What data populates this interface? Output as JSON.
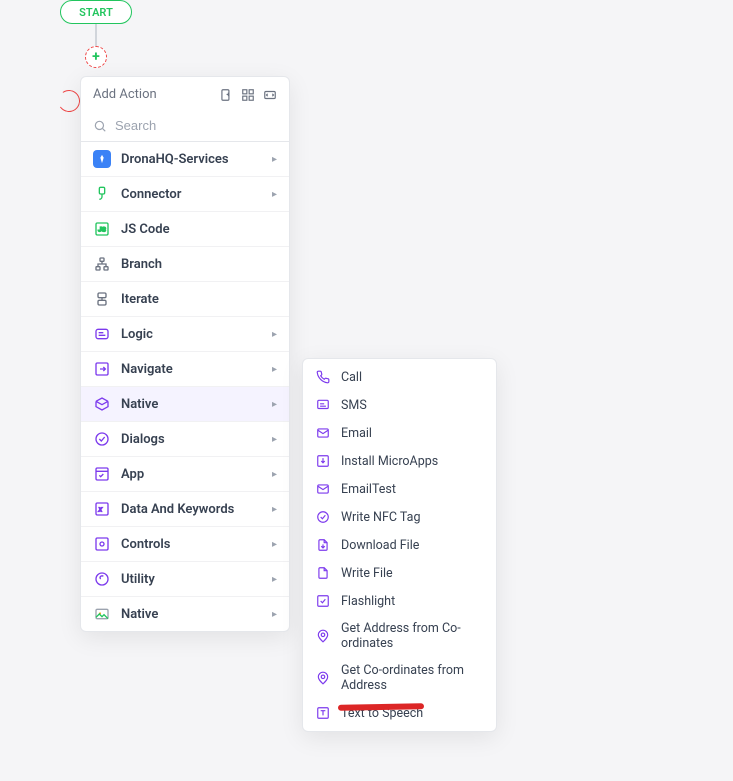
{
  "canvas": {
    "start_label": "START"
  },
  "menu": {
    "title": "Add Action",
    "search_placeholder": "Search",
    "items": [
      {
        "label": "DronaHQ-Services",
        "expand": true
      },
      {
        "label": "Connector",
        "expand": true
      },
      {
        "label": "JS Code",
        "expand": false
      },
      {
        "label": "Branch",
        "expand": false
      },
      {
        "label": "Iterate",
        "expand": false
      },
      {
        "label": "Logic",
        "expand": true
      },
      {
        "label": "Navigate",
        "expand": true
      },
      {
        "label": "Native",
        "expand": true
      },
      {
        "label": "Dialogs",
        "expand": true
      },
      {
        "label": "App",
        "expand": true
      },
      {
        "label": "Data And Keywords",
        "expand": true
      },
      {
        "label": "Controls",
        "expand": true
      },
      {
        "label": "Utility",
        "expand": true
      },
      {
        "label": "Native",
        "expand": true
      }
    ]
  },
  "submenu": {
    "items": [
      {
        "label": "Call"
      },
      {
        "label": "SMS"
      },
      {
        "label": "Email"
      },
      {
        "label": "Install MicroApps"
      },
      {
        "label": "EmailTest"
      },
      {
        "label": "Write NFC Tag"
      },
      {
        "label": "Download File"
      },
      {
        "label": "Write File"
      },
      {
        "label": "Flashlight"
      },
      {
        "label": "Get Address from Co-ordinates"
      },
      {
        "label": "Get Co-ordinates from Address"
      },
      {
        "label": "Text to Speech"
      }
    ]
  },
  "colors": {
    "accent": "#7c3aed"
  }
}
